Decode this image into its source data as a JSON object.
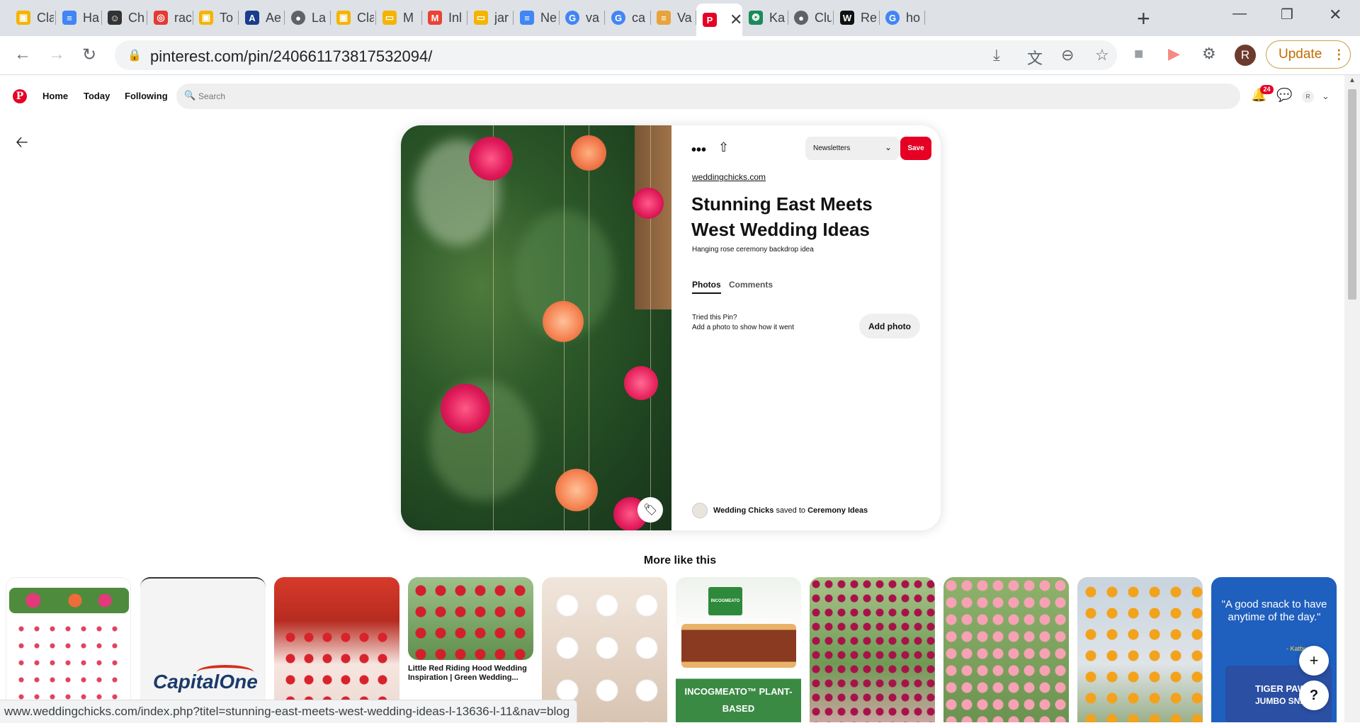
{
  "browser": {
    "tabs": [
      {
        "title": "Cla",
        "icon": "google-classroom-icon",
        "color": "#f4b400"
      },
      {
        "title": "Ha",
        "icon": "google-docs-icon",
        "color": "#4285f4"
      },
      {
        "title": "Ch",
        "icon": "sketch-face-icon",
        "color": "#333333"
      },
      {
        "title": "rac",
        "icon": "target-icon",
        "color": "#e53935"
      },
      {
        "title": "To",
        "icon": "google-classroom-icon",
        "color": "#f4b400"
      },
      {
        "title": "Ae",
        "icon": "letter-a-icon",
        "color": "#1a3c8c"
      },
      {
        "title": "La",
        "icon": "globe-icon",
        "color": "#5f6368"
      },
      {
        "title": "Cla",
        "icon": "google-classroom-icon",
        "color": "#f4b400"
      },
      {
        "title": "M",
        "icon": "google-slides-icon",
        "color": "#f4b400"
      },
      {
        "title": "Inl",
        "icon": "gmail-icon",
        "color": "#ea4335"
      },
      {
        "title": "jar",
        "icon": "google-slides-icon",
        "color": "#f4b400"
      },
      {
        "title": "Ne",
        "icon": "google-docs-icon",
        "color": "#4285f4"
      },
      {
        "title": "va",
        "icon": "google-icon",
        "color": "#4285f4"
      },
      {
        "title": "ca",
        "icon": "google-icon",
        "color": "#4285f4"
      },
      {
        "title": "Va",
        "icon": "layers-icon",
        "color": "#e8a33d"
      },
      {
        "title": "",
        "icon": "pinterest-icon",
        "color": "#e60023",
        "active": true
      },
      {
        "title": "Ka",
        "icon": "chat-bubbles-icon",
        "color": "#1b8a5a"
      },
      {
        "title": "Clu",
        "icon": "globe-icon",
        "color": "#5f6368"
      },
      {
        "title": "Re",
        "icon": "letter-w-icon",
        "color": "#111111"
      },
      {
        "title": "ho",
        "icon": "google-icon",
        "color": "#4285f4"
      }
    ],
    "url": "pinterest.com/pin/240661173817532094/",
    "profile_initial": "R",
    "update_label": "Update",
    "status_url": "www.weddingchicks.com/index.php?titel=stunning-east-meets-west-wedding-ideas-l-13636-l-11&nav=blog"
  },
  "pinterest": {
    "nav": {
      "home": "Home",
      "today": "Today",
      "following": "Following"
    },
    "search_placeholder": "Search",
    "notification_count": "24",
    "user_initial": "R"
  },
  "pin": {
    "board_select": "Newsletters",
    "save_label": "Save",
    "source": "weddingchicks.com",
    "title": "Stunning East Meets West Wedding Ideas",
    "description": "Hanging rose ceremony backdrop idea",
    "tabs": {
      "photos": "Photos",
      "comments": "Comments"
    },
    "tried_question": "Tried this Pin?",
    "tried_sub": "Add a photo to show how it went",
    "add_photo_label": "Add photo",
    "saver_name": "Wedding Chicks",
    "saved_to_text": "saved to",
    "board_name": "Ceremony Ideas"
  },
  "more_like_this": {
    "heading": "More like this",
    "items": [
      {
        "caption": ""
      },
      {
        "caption": "",
        "logo_text": "CapitalOne"
      },
      {
        "caption": ""
      },
      {
        "caption": "Little Red Riding Hood Wedding Inspiration | Green Wedding..."
      },
      {
        "caption": ""
      },
      {
        "caption": "",
        "badge_text": "INCOGMEATO",
        "banner_text": "INCOGMEATO™ PLANT-BASED"
      },
      {
        "caption": ""
      },
      {
        "caption": ""
      },
      {
        "caption": ""
      },
      {
        "caption": "",
        "ad_quote": "\"A good snack to have anytime of the day.\"",
        "ad_author": "- Katbun",
        "ad_brand": "TIGER PAWS",
        "ad_product": "JUMBO SNAX"
      }
    ]
  },
  "float_buttons": {
    "add": "+",
    "help": "?"
  }
}
